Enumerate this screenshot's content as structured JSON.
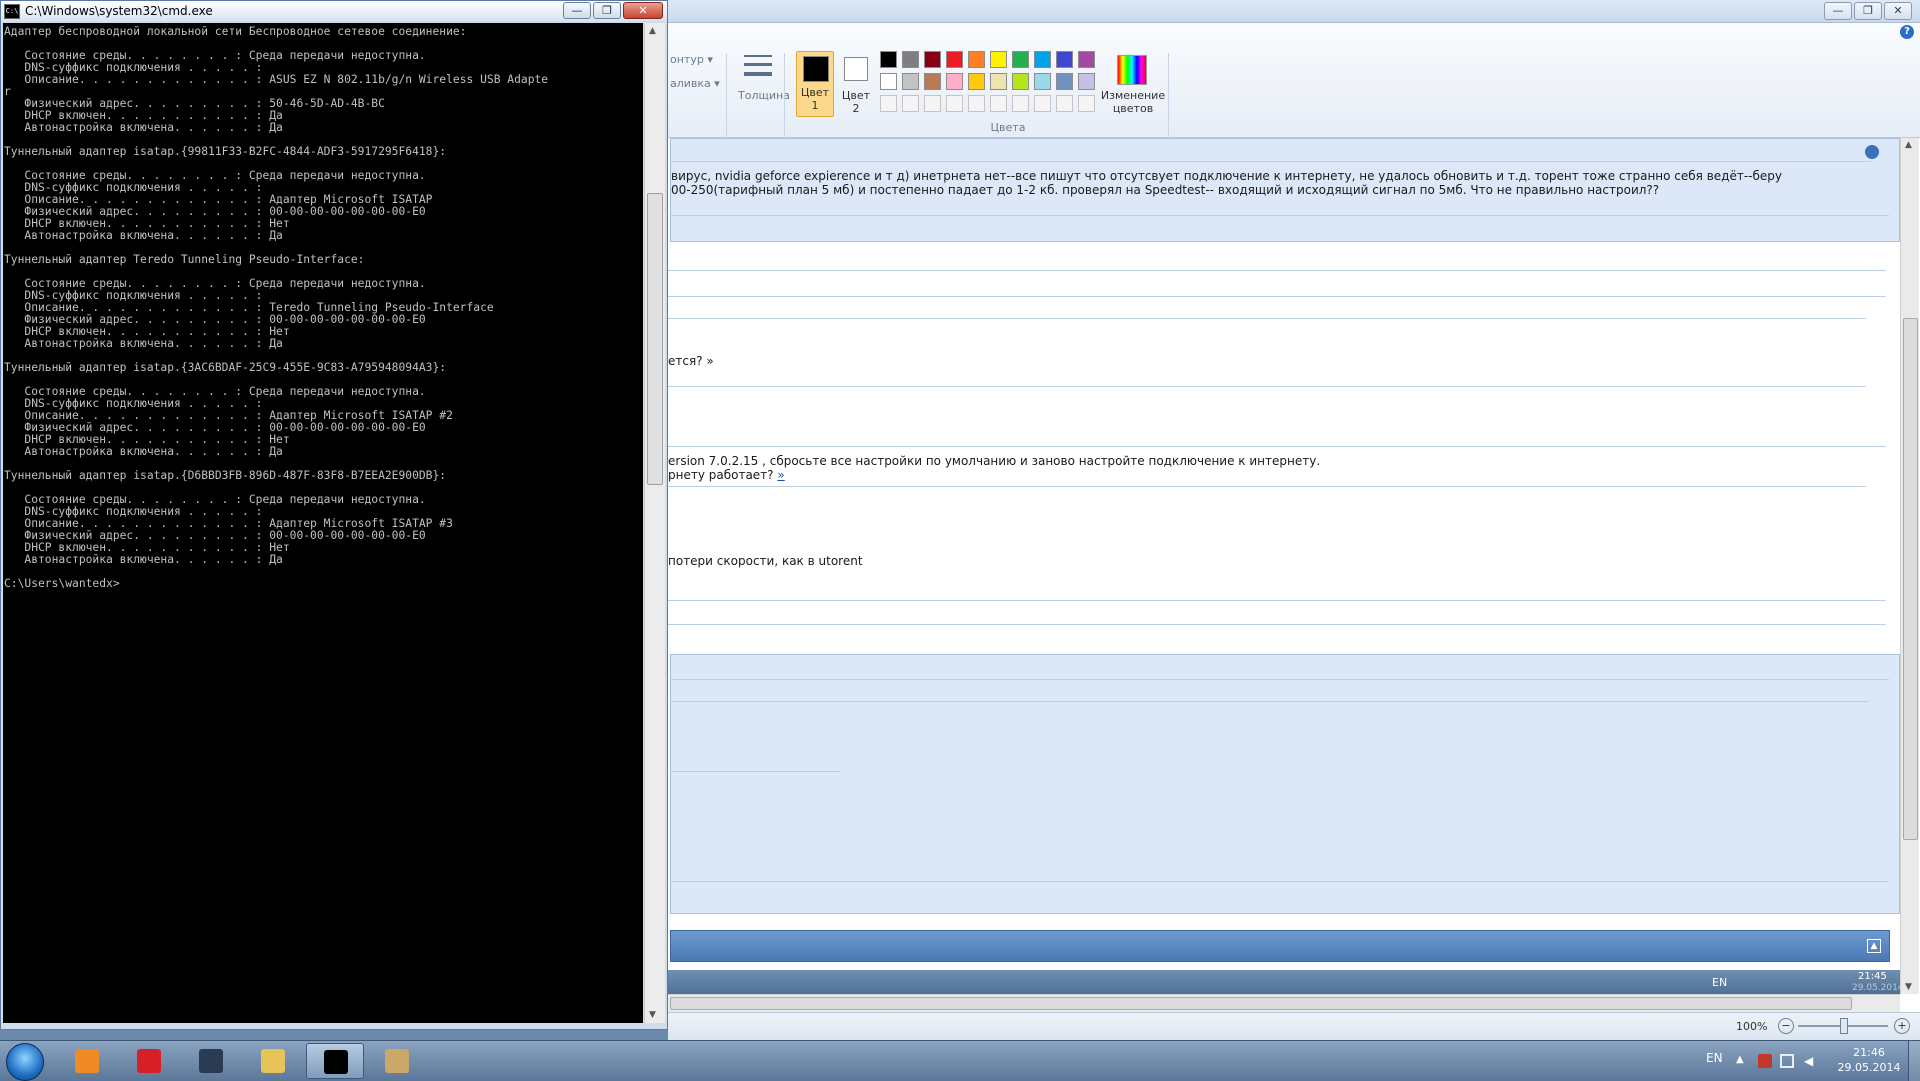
{
  "cmd": {
    "title": "C:\\Windows\\system32\\cmd.exe",
    "controls": {
      "minimize": "—",
      "maximize": "❐",
      "close": "✕"
    },
    "console_text": "Адаптер беспроводной локальной сети Беспроводное сетевое соединение:\n\n   Состояние среды. . . . . . . . : Среда передачи недоступна.\n   DNS-суффикс подключения . . . . . :\n   Описание. . . . . . . . . . . . . : ASUS EZ N 802.11b/g/n Wireless USB Adapte\nr\n   Физический адрес. . . . . . . . . : 50-46-5D-AD-4B-BC\n   DHCP включен. . . . . . . . . . . : Да\n   Автонастройка включена. . . . . . : Да\n\nТуннельный адаптер isatap.{99811F33-B2FC-4844-ADF3-5917295F6418}:\n\n   Состояние среды. . . . . . . . : Среда передачи недоступна.\n   DNS-суффикс подключения . . . . . :\n   Описание. . . . . . . . . . . . . : Адаптер Microsoft ISATAP\n   Физический адрес. . . . . . . . . : 00-00-00-00-00-00-00-E0\n   DHCP включен. . . . . . . . . . . : Нет\n   Автонастройка включена. . . . . . : Да\n\nТуннельный адаптер Teredo Tunneling Pseudo-Interface:\n\n   Состояние среды. . . . . . . . : Среда передачи недоступна.\n   DNS-суффикс подключения . . . . . :\n   Описание. . . . . . . . . . . . . : Teredo Tunneling Pseudo-Interface\n   Физический адрес. . . . . . . . . : 00-00-00-00-00-00-00-E0\n   DHCP включен. . . . . . . . . . . : Нет\n   Автонастройка включена. . . . . . : Да\n\nТуннельный адаптер isatap.{3AC6BDAF-25C9-455E-9C83-A795948094A3}:\n\n   Состояние среды. . . . . . . . : Среда передачи недоступна.\n   DNS-суффикс подключения . . . . . :\n   Описание. . . . . . . . . . . . . : Адаптер Microsoft ISATAP #2\n   Физический адрес. . . . . . . . . : 00-00-00-00-00-00-00-E0\n   DHCP включен. . . . . . . . . . . : Нет\n   Автонастройка включена. . . . . . : Да\n\nТуннельный адаптер isatap.{D6BBD3FB-896D-487F-83F8-B7EEA2E900DB}:\n\n   Состояние среды. . . . . . . . : Среда передачи недоступна.\n   DNS-суффикс подключения . . . . . :\n   Описание. . . . . . . . . . . . . : Адаптер Microsoft ISATAP #3\n   Физический адрес. . . . . . . . . : 00-00-00-00-00-00-00-E0\n   DHCP включен. . . . . . . . . . . : Нет\n   Автонастройка включена. . . . . . : Да\n\nC:\\Users\\wantedx>"
  },
  "paint": {
    "controls": {
      "minimize": "—",
      "maximize": "❐",
      "close": "✕"
    },
    "ribbon": {
      "outline_label": "онтур ▾",
      "fill_label": "аливка ▾",
      "size_label": "Толщина",
      "color1_label": "Цвет\n1",
      "color2_label": "Цвет\n2",
      "edit_colors_label": "Изменение\nцветов",
      "colors_group_label": "Цвета",
      "help_icon": "?"
    },
    "palette_row1": [
      "#000000",
      "#7f7f7f",
      "#880015",
      "#ed1c24",
      "#ff7f27",
      "#fff200",
      "#22b14c",
      "#00a2e8",
      "#3f48cc",
      "#a349a4"
    ],
    "palette_row2": [
      "#ffffff",
      "#c3c3c3",
      "#b97a57",
      "#ffaec9",
      "#ffc90e",
      "#efe4b0",
      "#b5e61d",
      "#99d9ea",
      "#7092be",
      "#c8bfe7"
    ],
    "forum": {
      "post_line1": "вирус, nvidia geforce expierence и т д) инетрнета нет--все пишут что отсутсвует подключение к интернету, не удалось обновить и т.д. торент тоже странно себя ведёт--беру",
      "post_line2": "00-250(тарифный план 5 мб) и постепенно падает до 1-2 кб. проверял на Speedtest-- входящий и исходящий сигнал по 5мб. Что не правильно настроил??",
      "quote1": "ется? »",
      "reply_line1": "ersion 7.0.2.15 , сбросьте все настройки по умолчанию и заново настройте подключение к интернету.",
      "reply_line2": "рнету работает? ",
      "reply_link": "»",
      "reply2": "потери скорости, как в utorent"
    },
    "inner_taskbar": {
      "lang": "EN",
      "time": "21:45",
      "date": "29.05.2014"
    },
    "status": {
      "zoom": "100%",
      "minus": "−",
      "plus": "+"
    }
  },
  "taskbar": {
    "apps": [
      {
        "name": "media-player",
        "color": "#f08a24"
      },
      {
        "name": "yandex-browser",
        "color": "#d61f26"
      },
      {
        "name": "steam",
        "color": "#2a3b52"
      },
      {
        "name": "explorer",
        "color": "#e8c35a"
      },
      {
        "name": "cmd",
        "color": "#000000"
      },
      {
        "name": "paint",
        "color": "#c9a86a"
      }
    ],
    "lang": "EN",
    "time": "21:46",
    "date": "29.05.2014"
  }
}
